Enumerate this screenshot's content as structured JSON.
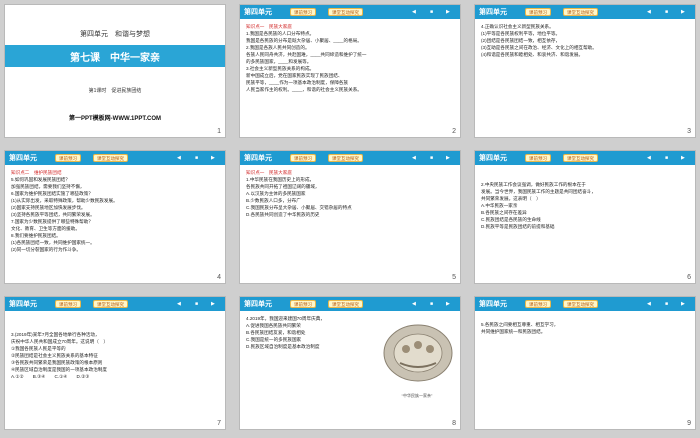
{
  "slides": [
    {
      "number": "1",
      "type": "title",
      "unit": "第四单元　和谐与梦想",
      "title": "第七课　中华一家亲",
      "subtitle": "第1课时　促进民族团结",
      "site": "第一PPT模板网-WWW.1PPT.COM"
    },
    {
      "number": "2",
      "header": {
        "unit": "第四单元",
        "tab1": "课前预习",
        "tab2": "课堂互动探究"
      },
      "lines": [
        {
          "text": "知识点一　民族大家庭",
          "style": "red"
        },
        {
          "text": "1.我国是各民族的人口分布特点。"
        },
        {
          "text": "我国是各民族的分布是既大杂居、小聚居、____的格局。"
        },
        {
          "text": "2.我国是各族人民共同创造的。"
        },
        {
          "text": "各族人民同舟共济，共赴国难，____共同缔造和维护了统一"
        },
        {
          "text": "的多民族国家，____和发展等。"
        },
        {
          "text": "3.社会主义新型民族关系的构成。"
        },
        {
          "text": "新中国成立后，党在国家民族实现了民族团结、"
        },
        {
          "text": "民族平等，____作为一项基本政治制度，保障各族"
        },
        {
          "text": "人民当家作主的权利。____，和谐的社会主义民族关系。"
        }
      ]
    },
    {
      "number": "3",
      "header": {
        "unit": "第四单元",
        "tab1": "课前预习",
        "tab2": "课堂互动探究"
      },
      "lines": [
        {
          "text": "4.正确认识社会主义新型民族关系。"
        },
        {
          "text": "(1)平等是各民族权利平等，地位平等。"
        },
        {
          "text": "(2)团结是各民族团结一致，相互依存，"
        },
        {
          "text": "(3)互助是各民族之间在政治、经济、文化上的相互帮助。"
        },
        {
          "text": "(4)和谐是各民族和睦相处、和衷共济、和谐发展。"
        }
      ]
    },
    {
      "number": "4",
      "header": {
        "unit": "第四单元",
        "tab1": "课前预习",
        "tab2": "课堂互动探究"
      },
      "lines": [
        {
          "text": "知识点二　维护民族团结",
          "style": "red"
        },
        {
          "text": "5.如何巩固和发展民族团结？"
        },
        {
          "text": "加强民族团结，需要我们坚持不懈，"
        },
        {
          "text": "6.国家为维护民族团结实施了哪些政策？"
        },
        {
          "text": "(1)从实际出发，采取特殊政策，帮助少数民族发展。"
        },
        {
          "text": "(2)国家支持民族地区加快发展步伐。"
        },
        {
          "text": "(3)坚持各民族平等团结，共同繁荣发展。"
        },
        {
          "text": "7.国家为少数民族提供了哪些特殊帮助？"
        },
        {
          "text": "文化、教育、卫生等方面的援助。"
        },
        {
          "text": "8.我们要维护民族团结。"
        },
        {
          "text": "(1)各民族团结一致，共同维护国家统一。"
        },
        {
          "text": "(2)同一切分裂国家的行为作斗争。"
        }
      ]
    },
    {
      "number": "5",
      "header": {
        "unit": "第四单元",
        "tab1": "课前预习",
        "tab2": "课堂互动探究"
      },
      "lines": [
        {
          "text": "知识点一　民族大家庭",
          "style": "red"
        },
        {
          "text": "1.中华民族在我国历史上的形成，"
        },
        {
          "text": "各民族共同开拓了祖国辽阔的疆域，"
        },
        {
          "text": "A.以汉族为主体的多民族国家"
        },
        {
          "text": "B.少数民族人口多，分布广"
        },
        {
          "text": "C.我国民族分布呈大杂居、小聚居、交错杂居的特点"
        },
        {
          "text": "D.各民族共同创造了中华民族的历史"
        }
      ]
    },
    {
      "number": "6",
      "header": {
        "unit": "第四单元",
        "tab1": "课前预习",
        "tab2": "课堂互动探究"
      },
      "lines": [
        {
          "text": "2.中央民族工作会议强调，做好民族工作的根本在于"
        },
        {
          "text": "发展。当今世界，我国民族工作的主题是共同团结奋斗，"
        },
        {
          "text": "共同繁荣发展。这表明（　）"
        },
        {
          "text": "A.中华民族一家亲"
        },
        {
          "text": "B.各民族之间存在差异"
        },
        {
          "text": "C.民族团结是各民族的生命线"
        },
        {
          "text": "D.民族平等是民族团结的前提和基础"
        }
      ]
    },
    {
      "number": "7",
      "header": {
        "unit": "第四单元",
        "tab1": "课前预习",
        "tab2": "课堂互动探究"
      },
      "lines": [
        {
          "text": "3.(2019年)某年7月全国各地举行各种活动，"
        },
        {
          "text": "庆祝中华人民共和国成立70周年。这说明（　）"
        },
        {
          "text": "①我国各民族人民是平等的"
        },
        {
          "text": "②民族团结是社会主义民族关系的基本特征"
        },
        {
          "text": "③各民族共同繁荣是我国民族政策的根本原则"
        },
        {
          "text": "④民族区域自治制度是我国的一项基本政治制度"
        },
        {
          "text": "A.①②　　B.③④　　C.①④　　D.②③"
        }
      ]
    },
    {
      "number": "8",
      "type": "emblem",
      "header": {
        "unit": "第四单元",
        "tab1": "课前预习",
        "tab2": "课堂互动探究"
      },
      "lines": [
        {
          "text": "4.2019年，我国迎来建国70周年庆典，"
        },
        {
          "text": "A.促进我国各民族共同繁荣"
        },
        {
          "text": "B.各民族团结友爱，和谐相处"
        },
        {
          "text": "C.我国是统一的多民族国家"
        },
        {
          "text": "D.民族区域自治制度是基本政治制度"
        }
      ],
      "caption": "“中华民族一家亲”"
    },
    {
      "number": "9",
      "header": {
        "unit": "第四单元",
        "tab1": "课前预习",
        "tab2": "课堂互动探究"
      },
      "lines": [
        {
          "text": "5.各民族之间要相互尊重、相互学习，"
        },
        {
          "text": "共同维护国家统一和民族团结。"
        }
      ]
    }
  ]
}
